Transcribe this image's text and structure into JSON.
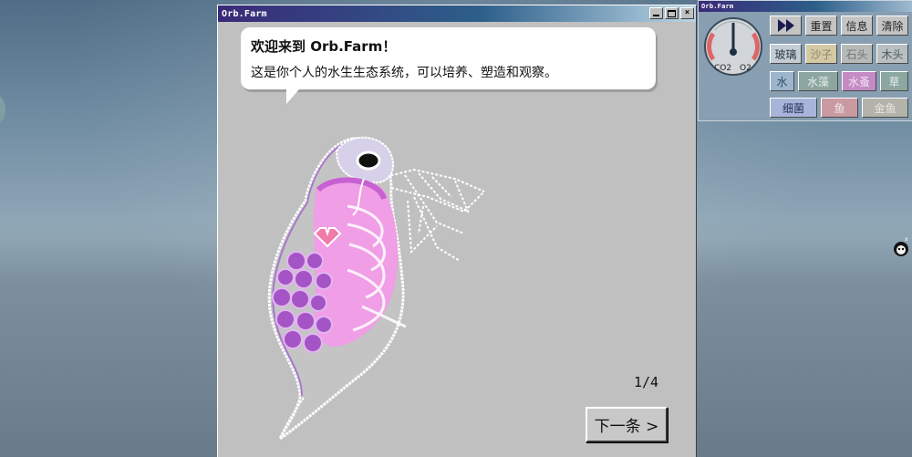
{
  "app": {
    "title": "Orb.Farm"
  },
  "window_controls": {
    "minimize": "",
    "maximize": "",
    "close": "×"
  },
  "tutorial": {
    "title": "欢迎来到 Orb.Farm！",
    "message": "这是你个人的水生生态系统，可以培养、塑造和观察。",
    "page": "1/4",
    "next_label": "下一条 >"
  },
  "side_panel": {
    "title": "Orb.Farm",
    "gauge": {
      "left_label": "CO2",
      "right_label": "O2",
      "needle": 0.5
    },
    "controls": {
      "reset": "重置",
      "info": "信息",
      "clear": "清除"
    },
    "materials": [
      {
        "key": "glass",
        "label": "玻璃",
        "color": "#c3ccd2",
        "text_color": "#2d3a44"
      },
      {
        "key": "sand",
        "label": "沙子",
        "color": "#d4c9a4",
        "text_color": "#8a8466"
      },
      {
        "key": "stone",
        "label": "石头",
        "color": "#b7bab9",
        "text_color": "#6f7576"
      },
      {
        "key": "wood",
        "label": "木头",
        "color": "#b9c0c2",
        "text_color": "#4f575b"
      },
      {
        "key": "water",
        "label": "水",
        "color": "#9db6ce",
        "text_color": "#33506e"
      },
      {
        "key": "algae",
        "label": "水藻",
        "color": "#8ea6a0",
        "text_color": "#e4ece8"
      },
      {
        "key": "daphnia",
        "label": "水蚤",
        "color": "#c48bc4",
        "text_color": "#f3e4f3"
      },
      {
        "key": "grass",
        "label": "草",
        "color": "#8ca6a0",
        "text_color": "#e8eeec"
      },
      {
        "key": "bacteria",
        "label": "细菌",
        "color": "#a9b5d8",
        "text_color": "#27305e"
      },
      {
        "key": "fish",
        "label": "鱼",
        "color": "#c99aa2",
        "text_color": "#f2e6e8"
      },
      {
        "key": "goldfish",
        "label": "金鱼",
        "color": "#b3b3a9",
        "text_color": "#e6e6dd"
      }
    ]
  }
}
